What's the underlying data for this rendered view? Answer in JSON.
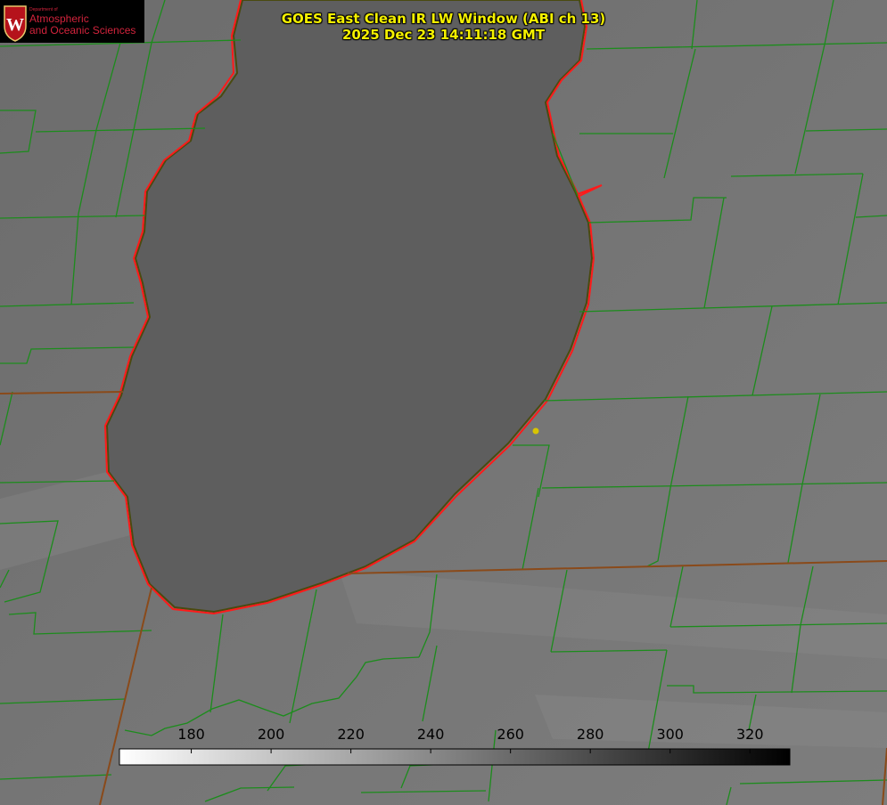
{
  "logo": {
    "department": "Department of",
    "line1": "Atmospheric",
    "line2": "and Oceanic Sciences",
    "crest_letter": "W",
    "crest_color": "#b5121b"
  },
  "title": {
    "line1": "GOES East Clean IR LW Window (ABI ch 13)",
    "line2": "2025 Dec 23 14:11:18 GMT"
  },
  "colorbar": {
    "ticks": [
      "180",
      "200",
      "220",
      "240",
      "260",
      "280",
      "300",
      "320"
    ],
    "range": [
      162,
      330
    ],
    "gradient": [
      "#ffffff",
      "#000000"
    ]
  },
  "colors": {
    "county_lines": "#1c8c1c",
    "lake_outline": "#ff1a1a",
    "state_lines": "#8a4a1a",
    "marker": "#d8c400",
    "label_text": "#f4f000"
  }
}
